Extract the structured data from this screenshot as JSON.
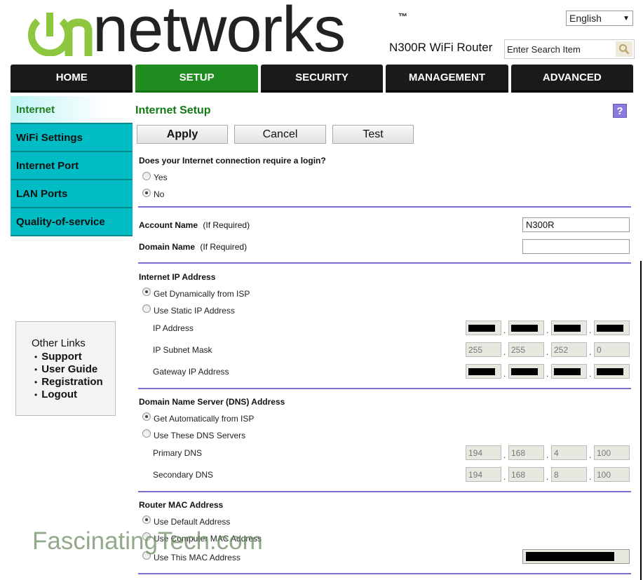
{
  "brand": {
    "name": "on networks",
    "tm": "™",
    "model": "N300R WiFi Router",
    "colors": {
      "green_logo": "#8dc63f",
      "nav_dark": "#1a1a1a",
      "nav_active": "#1e8c1e",
      "sidebar": "#00bcc4",
      "divider": "#7b6fd0",
      "title_green": "#137a13"
    }
  },
  "header": {
    "language": "English",
    "search_placeholder": "Enter Search Item",
    "search_icon": "magnifier-icon"
  },
  "nav": {
    "tabs": [
      {
        "label": "HOME"
      },
      {
        "label": "SETUP",
        "active": true
      },
      {
        "label": "SECURITY"
      },
      {
        "label": "MANAGEMENT"
      },
      {
        "label": "ADVANCED"
      }
    ]
  },
  "sidebar": {
    "items": [
      {
        "label": "Internet",
        "active": true
      },
      {
        "label": "WiFi Settings"
      },
      {
        "label": "Internet Port"
      },
      {
        "label": "LAN Ports"
      },
      {
        "label": "Quality-of-service"
      }
    ]
  },
  "other_links": {
    "title": "Other Links",
    "items": [
      "Support",
      "User Guide",
      "Registration",
      "Logout"
    ]
  },
  "main": {
    "title": "Internet Setup",
    "help": "?",
    "buttons": {
      "apply": "Apply",
      "cancel": "Cancel",
      "test": "Test"
    },
    "login_question": "Does your Internet connection require a login?",
    "login_options": {
      "yes": "Yes",
      "no": "No",
      "selected": "No"
    },
    "account_name_label": "Account Name",
    "account_name_hint": "(If Required)",
    "account_name_value": "N300R",
    "domain_name_label": "Domain Name",
    "domain_name_hint": "(If Required)",
    "domain_name_value": "",
    "ip_section": {
      "title": "Internet IP Address",
      "option_dynamic": "Get Dynamically from ISP",
      "option_static": "Use Static IP Address",
      "selected": "Get Dynamically from ISP",
      "ip_label": "IP Address",
      "subnet_label": "IP Subnet Mask",
      "gateway_label": "Gateway IP Address",
      "subnet": [
        "255",
        "255",
        "252",
        "0"
      ]
    },
    "dns_section": {
      "title": "Domain Name Server (DNS) Address",
      "option_auto": "Get Automatically from ISP",
      "option_manual": "Use These DNS Servers",
      "selected": "Get Automatically from ISP",
      "primary_label": "Primary DNS",
      "secondary_label": "Secondary DNS",
      "primary": [
        "194",
        "168",
        "4",
        "100"
      ],
      "secondary": [
        "194",
        "168",
        "8",
        "100"
      ]
    },
    "mac_section": {
      "title": "Router MAC Address",
      "option_default": "Use Default Address",
      "option_computer": "Use Computer MAC Address",
      "option_this": "Use This MAC Address",
      "selected": "Use Default Address"
    }
  },
  "watermark": "FascinatingTech.com"
}
